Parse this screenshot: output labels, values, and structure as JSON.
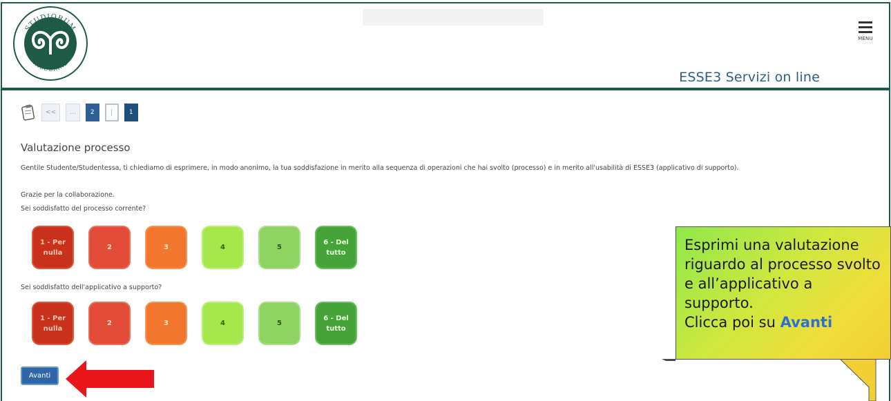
{
  "header": {
    "site_title": "ESSE3 Servizi on line",
    "menu_label": "MENU",
    "logo_text_top": "STUDIORUM",
    "logo_text_left": "UNIVERSITAS",
    "logo_text_right": "INSUBRIAE"
  },
  "breadcrumb": {
    "first_label": "<<",
    "ellipsis_label": "...",
    "page2_label": "2",
    "current_label": "|",
    "page1_label": "1"
  },
  "main": {
    "heading": "Valutazione processo",
    "intro": "Gentile Studente/Studentessa, ti chiediamo di esprimere, in modo anonimo, la tua soddisfazione in merito alla sequenza di operazioni che hai svolto (processo) e in merito all'usabilità di ESSE3 (applicativo di supporto).",
    "thanks": "Grazie per la collaborazione.",
    "question1": "Sei soddisfatto del processo corrente?",
    "question2": "Sei soddisfatto dell'applicativo a supporto?",
    "ratings": [
      {
        "label": "1 - Per nulla",
        "color": "#c8311c"
      },
      {
        "label": "2",
        "color": "#e34b39"
      },
      {
        "label": "3",
        "color": "#f2762d"
      },
      {
        "label": "4",
        "color": "#a6e84c"
      },
      {
        "label": "5",
        "color": "#8fd363"
      },
      {
        "label": "6 - Del tutto",
        "color": "#46a33a"
      }
    ],
    "submit_label": "Avanti"
  },
  "callout": {
    "text": "Esprimi una valutazione riguardo al processo svolto e all’applicativo a supporto.",
    "action_prefix": "Clicca poi su",
    "action_link": "Avanti"
  },
  "colors": {
    "brand_green": "#1f5a47",
    "title_blue": "#2c5f86",
    "button_blue": "#2f66a8",
    "arrow_red": "#e8151b"
  }
}
